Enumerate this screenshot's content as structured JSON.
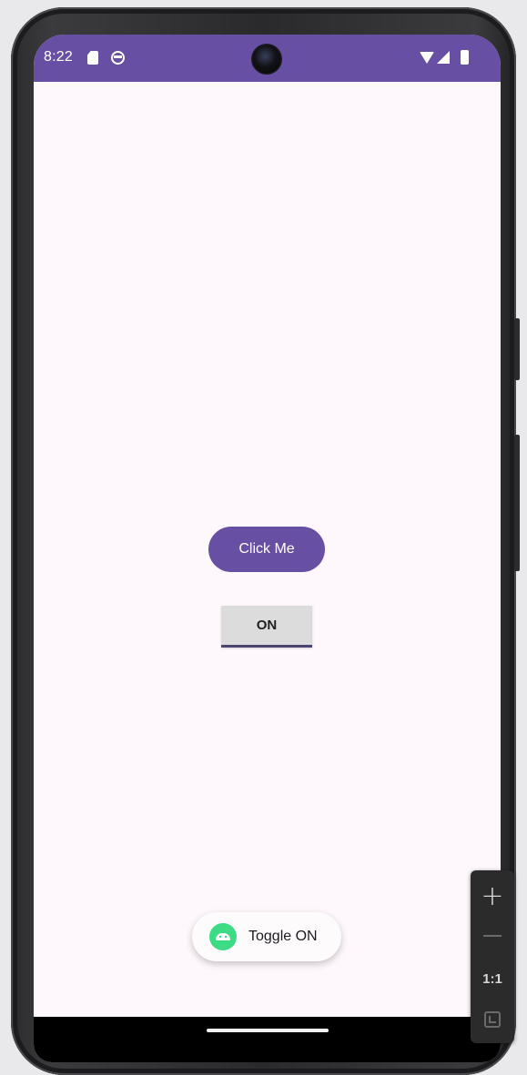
{
  "status_bar": {
    "time": "8:22",
    "background_color": "#6750a4",
    "icons": [
      "sd-card-icon",
      "sync-icon",
      "camera-icon",
      "wifi-icon",
      "signal-icon",
      "battery-icon"
    ]
  },
  "main": {
    "click_button_label": "Click Me",
    "toggle_button_label": "ON",
    "accent_color": "#6750a4",
    "background_color": "#fef7fb"
  },
  "toast": {
    "icon": "android-icon",
    "text": "Toggle ON"
  },
  "emulator_controls": {
    "zoom_in_label": "+",
    "actual_size_label": "1:1",
    "icons": [
      "zoom-in-icon",
      "zoom-out-icon",
      "fit-screen-icon"
    ]
  }
}
